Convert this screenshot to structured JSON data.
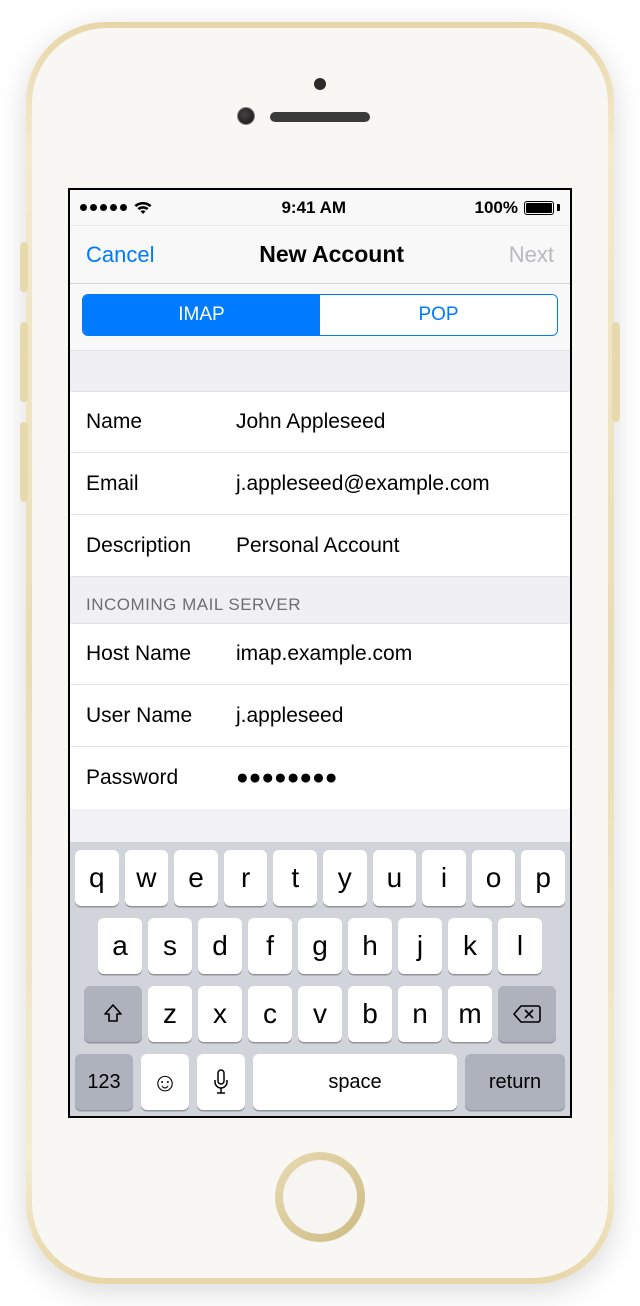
{
  "status": {
    "time": "9:41 AM",
    "battery_text": "100%"
  },
  "nav": {
    "cancel": "Cancel",
    "title": "New Account",
    "next": "Next"
  },
  "segments": {
    "imap": "IMAP",
    "pop": "POP"
  },
  "account": {
    "name_label": "Name",
    "name_value": "John Appleseed",
    "email_label": "Email",
    "email_value": "j.appleseed@example.com",
    "description_label": "Description",
    "description_value": "Personal Account"
  },
  "incoming": {
    "header": "INCOMING MAIL SERVER",
    "host_label": "Host Name",
    "host_value": "imap.example.com",
    "user_label": "User Name",
    "user_value": "j.appleseed",
    "password_label": "Password",
    "password_value": "●●●●●●●●"
  },
  "keyboard": {
    "row1": [
      "q",
      "w",
      "e",
      "r",
      "t",
      "y",
      "u",
      "i",
      "o",
      "p"
    ],
    "row2": [
      "a",
      "s",
      "d",
      "f",
      "g",
      "h",
      "j",
      "k",
      "l"
    ],
    "row3": [
      "z",
      "x",
      "c",
      "v",
      "b",
      "n",
      "m"
    ],
    "num": "123",
    "space": "space",
    "return": "return"
  }
}
